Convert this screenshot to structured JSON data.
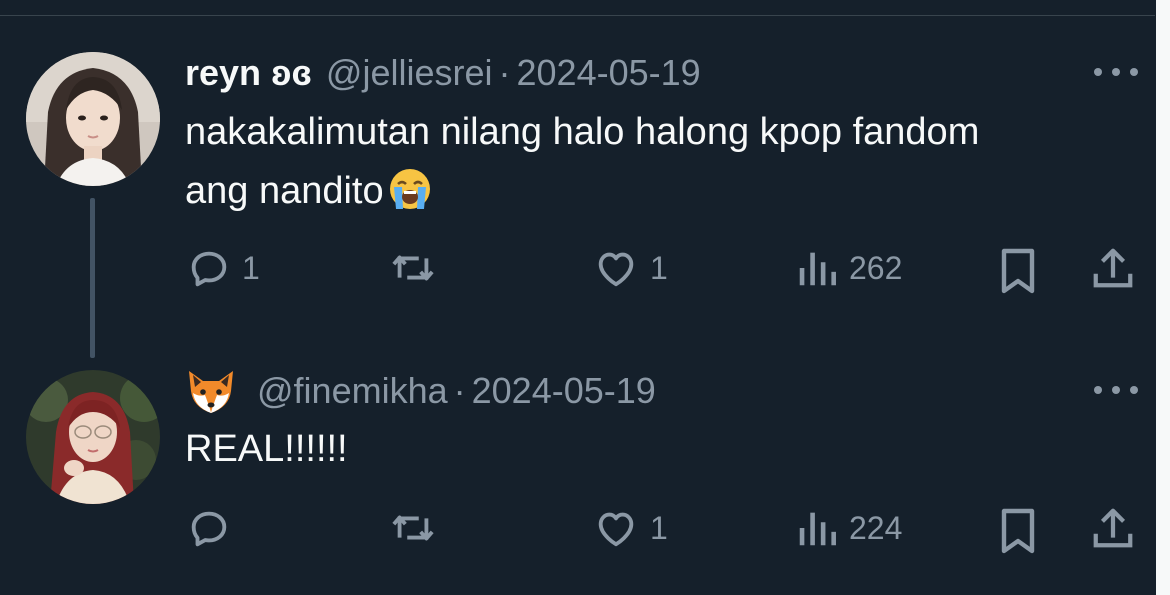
{
  "tweets": [
    {
      "display_name": "reyn ʚɞ",
      "handle": "@jelliesrei",
      "separator": "·",
      "date": "2024-05-19",
      "text_line1": "nakakalimutan nilang halo halong kpop fandom",
      "text_line2": "ang nandito",
      "text_emoji": "loudly-crying-face",
      "stats": {
        "replies": "1",
        "reposts": "",
        "likes": "1",
        "views": "262"
      }
    },
    {
      "display_name_emoji": "fox-face",
      "handle": "@finemikha",
      "separator": "·",
      "date": "2024-05-19",
      "text": "REAL!!!!!!",
      "stats": {
        "replies": "",
        "reposts": "",
        "likes": "1",
        "views": "224"
      }
    }
  ],
  "icons": {
    "reply": "reply-icon",
    "repost": "repost-icon",
    "like": "like-icon",
    "views": "views-icon",
    "bookmark": "bookmark-icon",
    "share": "share-icon",
    "more": "more-icon"
  },
  "colors": {
    "background": "#15202b",
    "primary_text": "#f7f9f9",
    "secondary_text": "#8b98a5",
    "thread_line": "#425364",
    "divider": "#38444d"
  }
}
